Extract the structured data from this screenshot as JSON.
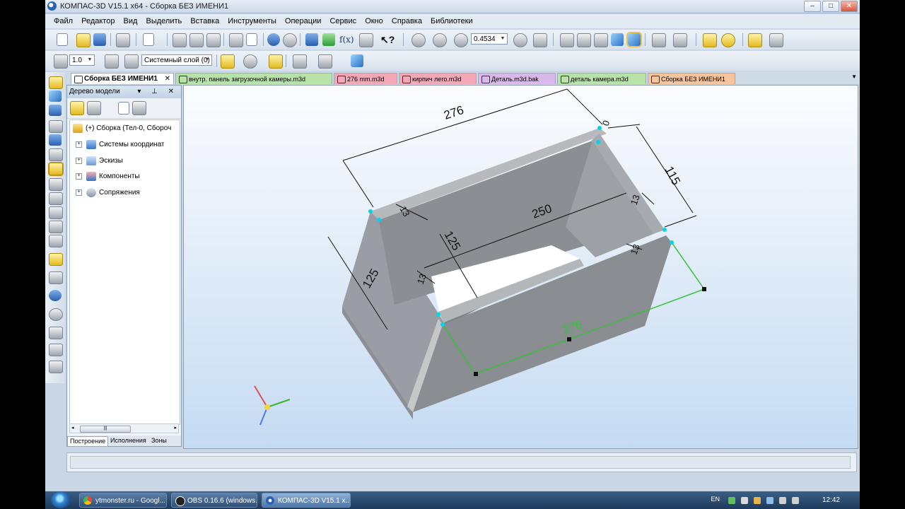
{
  "window": {
    "title": "КОМПАС-3D V15.1 x64 - Сборка БЕЗ ИМЕНИ1",
    "controls": [
      "–",
      "□",
      "✕"
    ]
  },
  "menu": [
    "Файл",
    "Редактор",
    "Вид",
    "Выделить",
    "Вставка",
    "Инструменты",
    "Операции",
    "Сервис",
    "Окно",
    "Справка",
    "Библиотеки"
  ],
  "toolbar": {
    "zoom_value": "0.4534",
    "step_value": "1.0",
    "layer_value": "Системный слой (0)"
  },
  "doc_tabs": [
    {
      "label": "Сборка БЕЗ ИМЕНИ1",
      "color": "#ffffff",
      "close": "✕"
    },
    {
      "label": "внутр. панель загрузочной камеры.m3d",
      "color": "#b8e3a8"
    },
    {
      "label": "276 mm.m3d",
      "color": "#f4a7b4"
    },
    {
      "label": "кирпич лего.m3d",
      "color": "#f4a7b4"
    },
    {
      "label": "Деталь.m3d.bak",
      "color": "#d9b8ea"
    },
    {
      "label": "деталь камера.m3d",
      "color": "#b8e3a8"
    },
    {
      "label": "Сборка БЕЗ ИМЕНИ1",
      "color": "#f7c49b"
    }
  ],
  "tree": {
    "title": "Дерево модели",
    "controls": "▾ ⊥ ✕",
    "root": "(+) Сборка (Тел-0, Сбороч",
    "items": [
      "Системы координат",
      "Эскизы",
      "Компоненты",
      "Сопряжения"
    ],
    "bottom_tabs": [
      "Построение",
      "Исполнения",
      "Зоны"
    ]
  },
  "dimensions": {
    "top_length": "276",
    "right_height": "115",
    "inner_length": "250",
    "inner_depth": "125",
    "left_depth": "125",
    "wall_a": "13",
    "wall_b": "13",
    "wall_c": "13",
    "wall_d": "13",
    "zero": "0",
    "front_length": "276"
  },
  "taskbar": {
    "tasks": [
      "ytmonster.ru - Googl...",
      "OBS 0.16.6 (windows...",
      "КОМПАС-3D V15.1 x..."
    ],
    "lang": "EN",
    "clock": "12:42"
  }
}
